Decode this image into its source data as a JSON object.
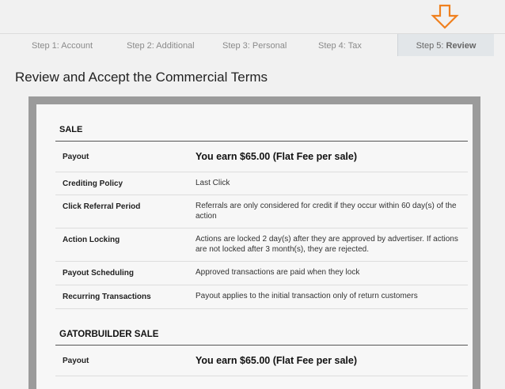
{
  "steps": [
    {
      "label": "Step 1: Account"
    },
    {
      "label": "Step 2: Additional"
    },
    {
      "label": "Step 3: Personal"
    },
    {
      "label": "Step 4: Tax"
    },
    {
      "prefix": "Step 5: ",
      "label": "Review"
    }
  ],
  "indicator": {
    "icon": "arrow-down-icon",
    "color": "#f0801e"
  },
  "page": {
    "title": "Review and Accept the Commercial Terms"
  },
  "sections": [
    {
      "title": "SALE",
      "rows": [
        {
          "label": "Payout",
          "value": "You earn $65.00 (Flat Fee per sale)"
        },
        {
          "label": "Crediting Policy",
          "value": "Last Click"
        },
        {
          "label": "Click Referral Period",
          "value": "Referrals are only considered for credit if they occur within 60 day(s) of the action"
        },
        {
          "label": "Action Locking",
          "value": "Actions are locked 2 day(s) after they are approved by advertiser. If actions are not locked after 3 month(s), they are rejected."
        },
        {
          "label": "Payout Scheduling",
          "value": "Approved transactions are paid when they lock"
        },
        {
          "label": "Recurring Transactions",
          "value": "Payout applies to the initial transaction only of return customers"
        }
      ]
    },
    {
      "title": "GATORBUILDER SALE",
      "rows": [
        {
          "label": "Payout",
          "value": "You earn $65.00 (Flat Fee per sale)"
        }
      ]
    }
  ]
}
